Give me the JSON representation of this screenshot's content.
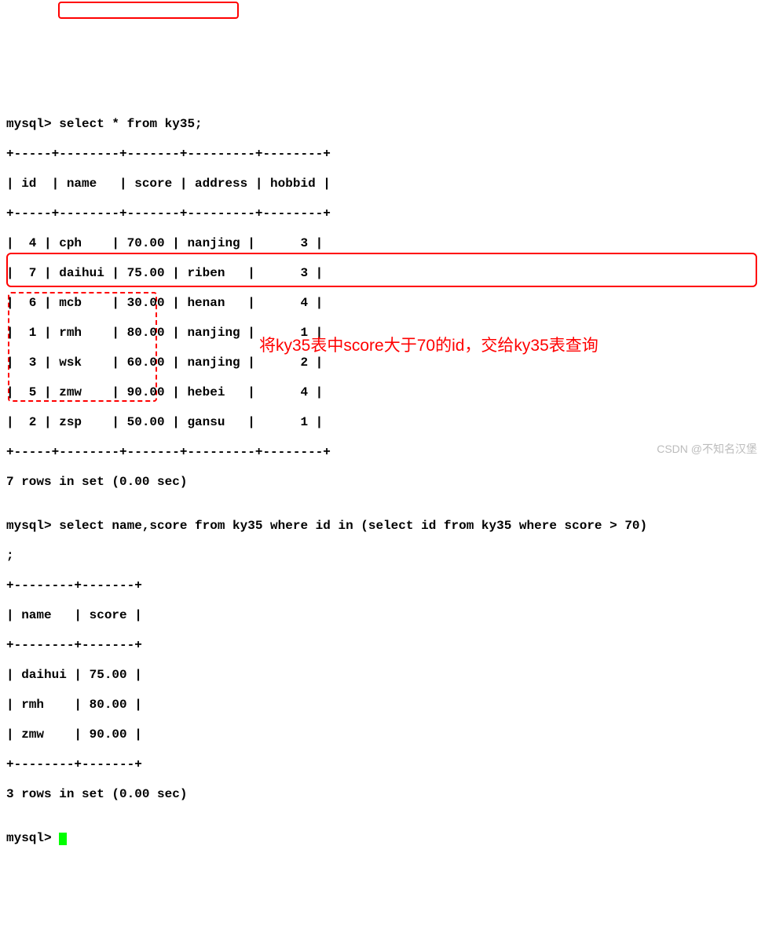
{
  "prompt1": "mysql> ",
  "query1": "select * from ky35;",
  "table1_border_top": "+-----+--------+-------+---------+--------+",
  "table1_header": "| id  | name   | score | address | hobbid |",
  "table1_border_mid": "+-----+--------+-------+---------+--------+",
  "table1_rows": [
    "|  4 | cph    | 70.00 | nanjing |      3 |",
    "|  7 | daihui | 75.00 | riben   |      3 |",
    "|  6 | mcb    | 30.00 | henan   |      4 |",
    "|  1 | rmh    | 80.00 | nanjing |      1 |",
    "|  3 | wsk    | 60.00 | nanjing |      2 |",
    "|  5 | zmw    | 90.00 | hebei   |      4 |",
    "|  2 | zsp    | 50.00 | gansu   |      1 |"
  ],
  "table1_border_bot": "+-----+--------+-------+---------+--------+",
  "result1_status": "7 rows in set (0.00 sec)",
  "blank": "",
  "query2_line1": "mysql> select name,score from ky35 where id in (select id from ky35 where score > 70)",
  "query2_line2": ";",
  "table2_border_top": "+--------+-------+",
  "table2_header": "| name   | score |",
  "table2_border_mid": "+--------+-------+",
  "table2_rows": [
    "| daihui | 75.00 |",
    "| rmh    | 80.00 |",
    "| zmw    | 90.00 |"
  ],
  "table2_border_bot": "+--------+-------+",
  "result2_status": "3 rows in set (0.00 sec)",
  "prompt3": "mysql> ",
  "annotation_text": "将ky35表中score大于70的id，交给ky35表查询",
  "watermark_text": "CSDN @不知名汉堡"
}
